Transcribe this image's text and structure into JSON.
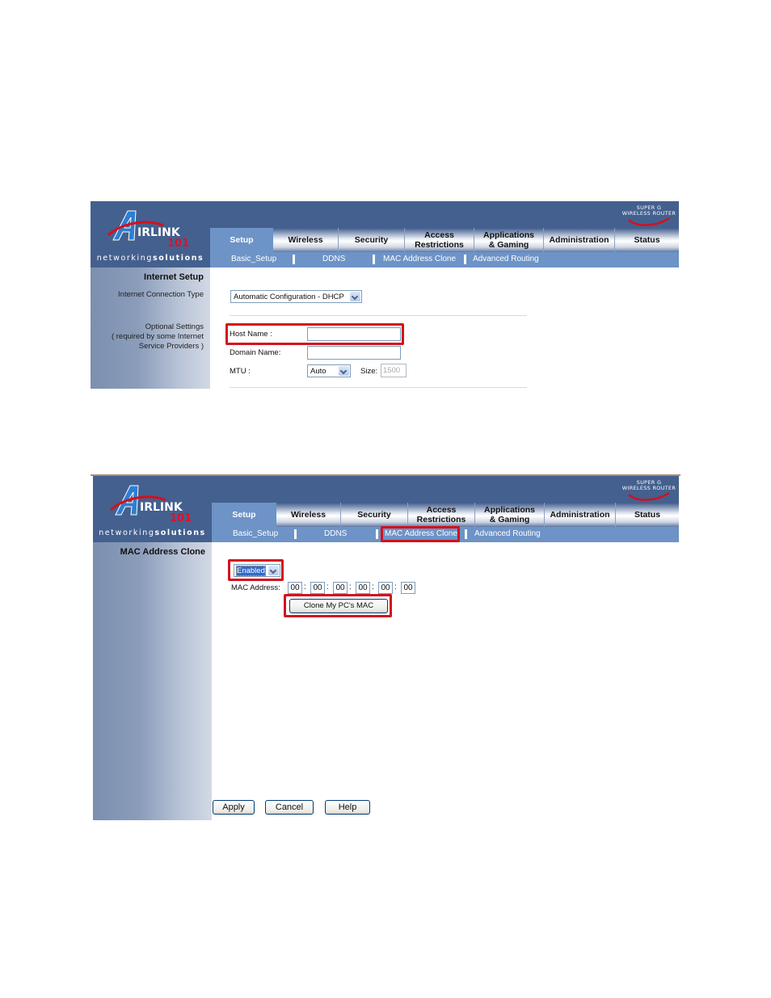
{
  "screens": [
    {
      "logo": {
        "brand": "AIRLINK",
        "number": "101",
        "tagline_a": "networking",
        "tagline_b": "solutions"
      },
      "product_badge": {
        "line1": "SUPER G",
        "line2": "WIRELESS ROUTER"
      },
      "tabs": [
        {
          "label": "Setup",
          "active": true
        },
        {
          "label": "Wireless",
          "active": false
        },
        {
          "label": "Security",
          "active": false
        },
        {
          "label": "Access Restrictions",
          "active": false
        },
        {
          "label": "Applications & Gaming",
          "active": false
        },
        {
          "label": "Administration",
          "active": false
        },
        {
          "label": "Status",
          "active": false
        }
      ],
      "subnav": [
        "Basic_Setup",
        "DDNS",
        "MAC Address Clone",
        "Advanced Routing"
      ],
      "sidebar": {
        "title": "Internet Setup",
        "connection_type_label": "Internet Connection Type",
        "optional_label_1": "Optional Settings",
        "optional_label_2": "( required by some Internet",
        "optional_label_3": "Service Providers )"
      },
      "form": {
        "connection_type": "Automatic Configuration - DHCP",
        "host_name_label": "Host Name :",
        "host_name_value": "",
        "domain_name_label": "Domain Name:",
        "domain_name_value": "",
        "mtu_label": "MTU :",
        "mtu_value": "Auto",
        "size_label": "Size:",
        "size_value": "1500"
      }
    },
    {
      "logo": {
        "brand": "AIRLINK",
        "number": "101",
        "tagline_a": "networking",
        "tagline_b": "solutions"
      },
      "product_badge": {
        "line1": "SUPER G",
        "line2": "WIRELESS ROUTER"
      },
      "tabs": [
        {
          "label": "Setup",
          "active": true
        },
        {
          "label": "Wireless",
          "active": false
        },
        {
          "label": "Security",
          "active": false
        },
        {
          "label": "Access Restrictions",
          "active": false
        },
        {
          "label": "Applications & Gaming",
          "active": false
        },
        {
          "label": "Administration",
          "active": false
        },
        {
          "label": "Status",
          "active": false
        }
      ],
      "subnav": [
        "Basic_Setup",
        "DDNS",
        "MAC Address Clone",
        "Advanced Routing"
      ],
      "sidebar": {
        "title": "MAC Address Clone"
      },
      "form": {
        "clone_state": "Enabled",
        "mac_label": "MAC Address:",
        "mac_octets": [
          "00",
          "00",
          "00",
          "00",
          "00",
          "00"
        ],
        "clone_button": "Clone My PC's MAC"
      },
      "buttons": {
        "apply": "Apply",
        "cancel": "Cancel",
        "help": "Help"
      }
    }
  ],
  "highlight_color": "#d4101c",
  "header_color": "#44608f",
  "active_tab_color": "#6d93c7"
}
